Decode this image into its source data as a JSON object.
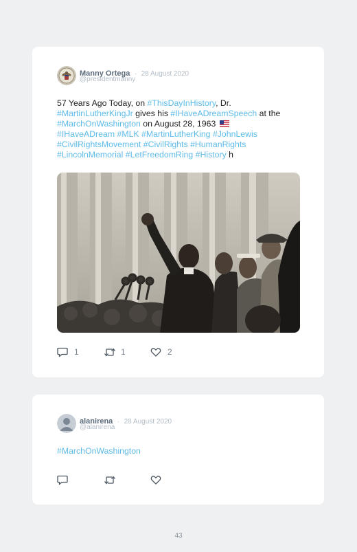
{
  "tweets": [
    {
      "name": "Manny Ortega",
      "separator": "·",
      "date": "28 August 2020",
      "handle": "@presidentmanny",
      "text_parts": [
        {
          "t": "57 Years Ago Today, on "
        },
        {
          "t": "#ThisDayInHistory",
          "tag": true
        },
        {
          "t": ", Dr. "
        },
        {
          "t": "#MartinLutherKingJr",
          "tag": true
        },
        {
          "t": " gives his "
        },
        {
          "t": "#IHaveADreamSpeech",
          "tag": true
        },
        {
          "t": " at the "
        },
        {
          "t": "#MarchOnWashington",
          "tag": true
        },
        {
          "t": " on August 28, 1963 "
        },
        {
          "flag": true
        },
        {
          "br": true
        },
        {
          "t": "#IHaveADream",
          "tag": true
        },
        {
          "t": " "
        },
        {
          "t": "#MLK",
          "tag": true
        },
        {
          "t": " "
        },
        {
          "t": "#MartinLutherKing",
          "tag": true
        },
        {
          "t": " "
        },
        {
          "t": "#JohnLewis",
          "tag": true
        },
        {
          "t": " "
        },
        {
          "t": "#CivilRightsMovement",
          "tag": true
        },
        {
          "t": " "
        },
        {
          "t": "#CivilRights",
          "tag": true
        },
        {
          "t": " "
        },
        {
          "t": "#HumanRights",
          "tag": true
        },
        {
          "t": " "
        },
        {
          "t": "#LincolnMemorial",
          "tag": true
        },
        {
          "t": " "
        },
        {
          "t": "#LetFreedomRing",
          "tag": true
        },
        {
          "t": " "
        },
        {
          "t": "#History",
          "tag": true
        },
        {
          "t": " h"
        }
      ],
      "replies": "1",
      "retweets": "1",
      "likes": "2"
    },
    {
      "name": "alanirena",
      "separator": "·",
      "date": "28 August 2020",
      "handle": "@alanirena",
      "text": "#MarchOnWashington"
    }
  ],
  "colors": {
    "hashtag": "#5dbbe8",
    "name": "#5c6b7b",
    "muted": "#b2bcc6",
    "background": "#eef0f2"
  },
  "icons": {
    "reply": "speech-bubble-icon",
    "retweet": "retweet-icon",
    "like": "heart-icon",
    "flag": "us-flag-icon"
  },
  "page_number": "43"
}
